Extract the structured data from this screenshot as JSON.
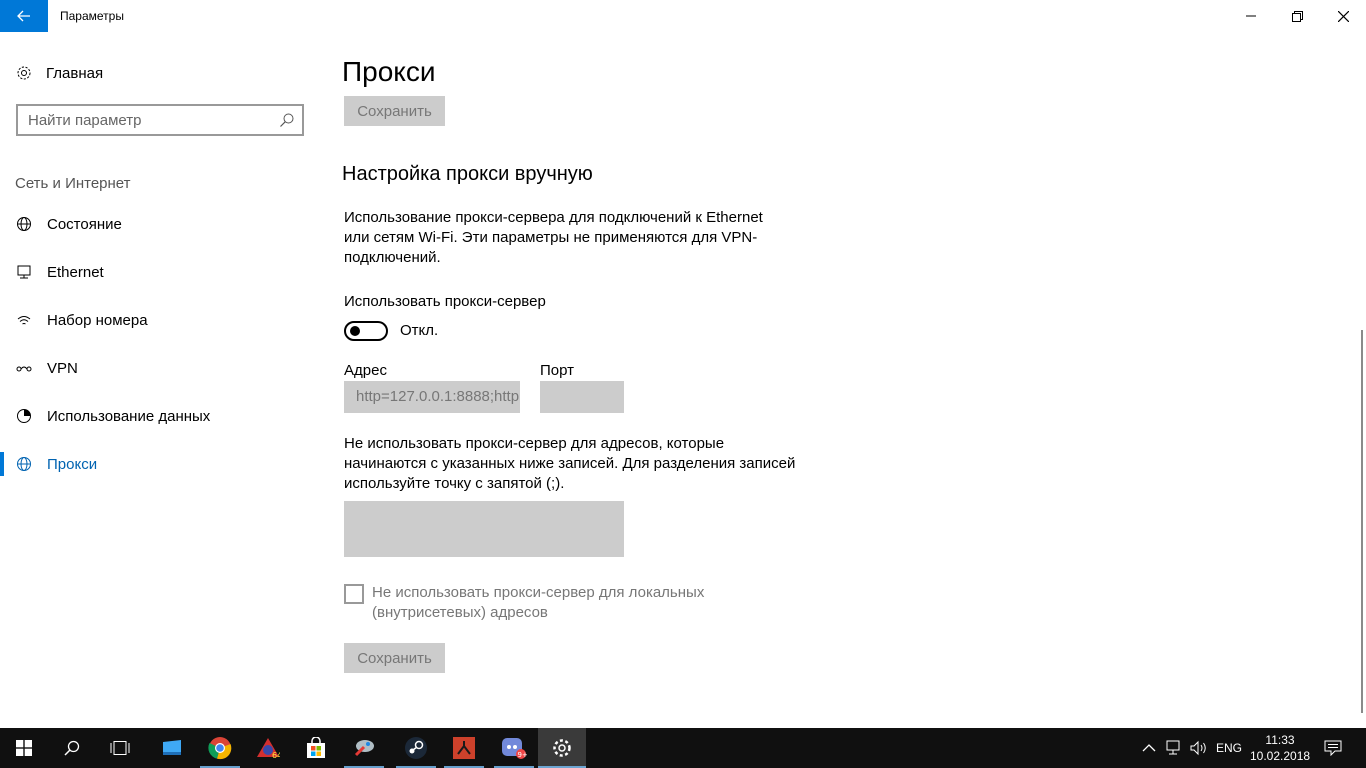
{
  "window": {
    "title": "Параметры",
    "back_icon": "arrow-left-icon",
    "minimize_icon": "minimize-icon",
    "restore_icon": "restore-icon",
    "close_icon": "close-icon"
  },
  "sidebar": {
    "home_label": "Главная",
    "search_placeholder": "Найти параметр",
    "section_label": "Сеть и Интернет",
    "items": [
      {
        "label": "Состояние",
        "icon": "globe-status-icon"
      },
      {
        "label": "Ethernet",
        "icon": "ethernet-icon"
      },
      {
        "label": "Набор номера",
        "icon": "dialup-icon"
      },
      {
        "label": "VPN",
        "icon": "vpn-icon"
      },
      {
        "label": "Использование данных",
        "icon": "data-usage-icon"
      },
      {
        "label": "Прокси",
        "icon": "globe-icon",
        "active": true
      }
    ]
  },
  "main": {
    "title": "Прокси",
    "save_top_label": "Сохранить",
    "section_title": "Настройка прокси вручную",
    "description_lines": [
      "Использование прокси-сервера для подключений к Ethernet",
      "или сетям Wi-Fi. Эти параметры не применяются для VPN-",
      "подключений."
    ],
    "use_proxy_label": "Использовать прокси-сервер",
    "toggle_state": "Откл.",
    "address_label": "Адрес",
    "address_value": "http=127.0.0.1:8888;http",
    "port_label": "Порт",
    "port_value": "",
    "exceptions_lines": [
      "Не использовать прокси-сервер для адресов, которые",
      "начинаются с указанных ниже записей. Для разделения записей",
      "используйте точку с запятой (;)."
    ],
    "local_checkbox_lines": [
      "Не использовать прокси-сервер для локальных",
      "(внутрисетевых) адресов"
    ],
    "save_bottom_label": "Сохранить"
  },
  "taskbar": {
    "apps": [
      "start-icon",
      "search-icon",
      "task-view-icon",
      "explorer-icon",
      "chrome-icon",
      "aida64-icon",
      "store-icon",
      "app-icon",
      "steam-icon",
      "rust-icon",
      "discord-icon",
      "settings-icon"
    ],
    "language": "ENG",
    "time": "11:33",
    "date": "10.02.2018",
    "accent": "#0078d7"
  }
}
